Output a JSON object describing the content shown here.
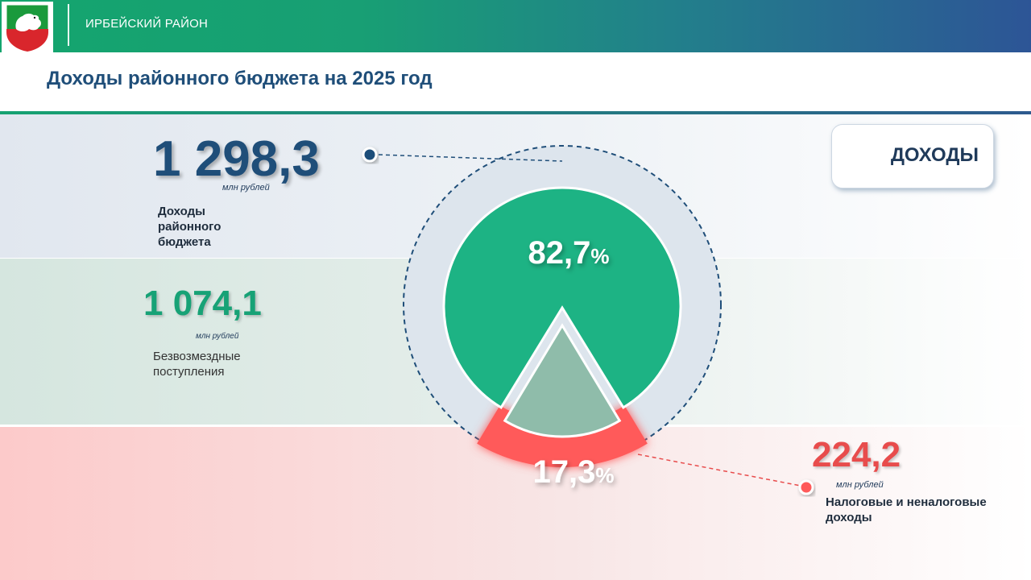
{
  "header": {
    "district": "ИРБЕЙСКИЙ РАЙОН",
    "title": "Доходы районного бюджета на 2025 год",
    "logo_icon": "coat-of-arms-icon"
  },
  "legend": {
    "label": "ДОХОДЫ"
  },
  "total": {
    "value": "1 298,3",
    "unit": "млн рублей",
    "label": "Доходы районного бюджета"
  },
  "gratuitous": {
    "value": "1 074,1",
    "unit": "млн рублей",
    "label": "Безвозмездные поступления"
  },
  "tax": {
    "value": "224,2",
    "unit": "млн рублей",
    "label": "Налоговые и неналоговые доходы"
  },
  "colors": {
    "green": "#1db384",
    "red": "#ff5a5a",
    "navy": "#1f4e79"
  },
  "chart_data": {
    "type": "pie",
    "slices": [
      {
        "label": "Безвозмездные поступления",
        "value": 1074.1,
        "percent": 82.7,
        "percent_text": "82,7",
        "color": "#1db384"
      },
      {
        "label": "Налоговые и неналоговые доходы",
        "value": 224.2,
        "percent": 17.3,
        "percent_text": "17,3",
        "color": "#ff5a5a"
      }
    ],
    "percent_sign": "%",
    "total": 1298.3
  }
}
